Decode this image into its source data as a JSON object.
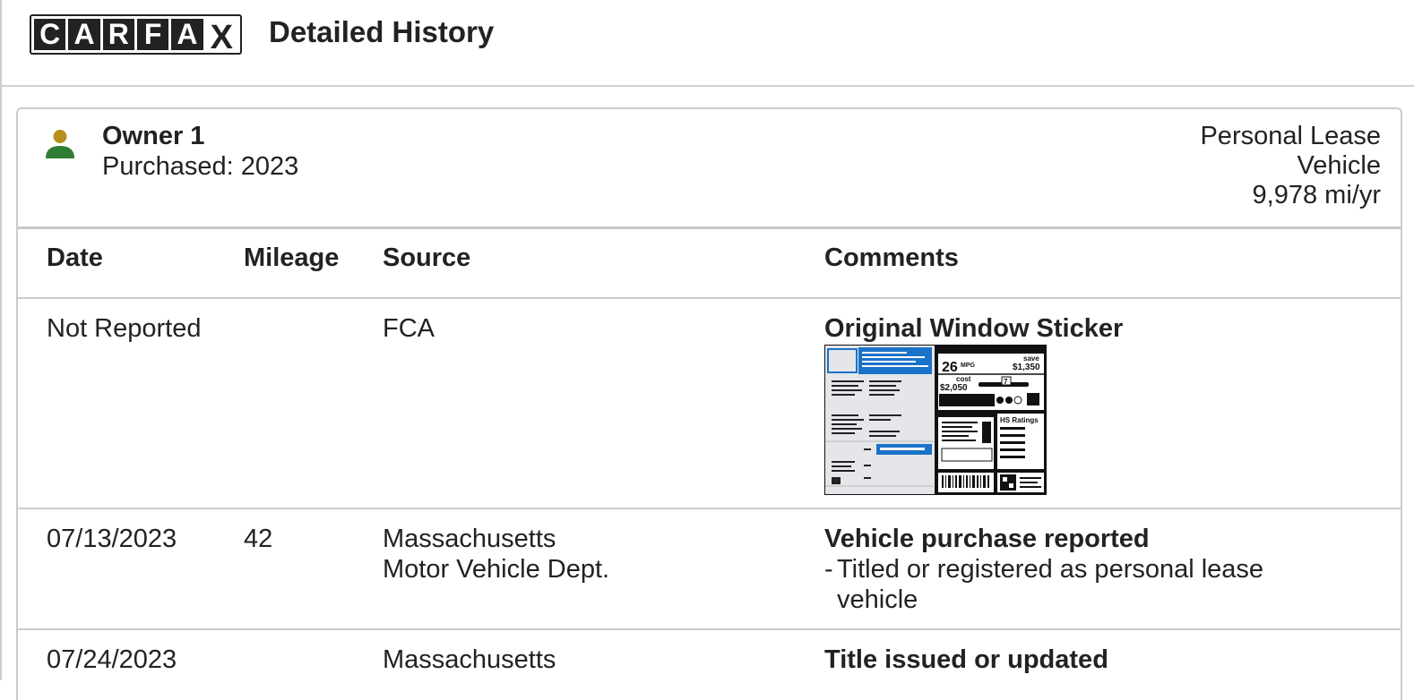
{
  "header": {
    "logo_letters": [
      "C",
      "A",
      "R",
      "F",
      "A",
      "X"
    ],
    "title": "Detailed History"
  },
  "owner": {
    "name": "Owner 1",
    "purchased": "Purchased: 2023",
    "type_line1": "Personal Lease",
    "type_line2": "Vehicle",
    "mileage_per_year": "9,978 mi/yr",
    "icon": "person-icon",
    "colors": {
      "head": "#b8901e",
      "body": "#2e7d32"
    }
  },
  "table": {
    "headers": [
      "Date",
      "Mileage",
      "Source",
      "Comments"
    ],
    "rows": [
      {
        "date": "Not Reported",
        "mileage": "",
        "source_line1": "FCA",
        "source_line2": "",
        "comment_title": "Original Window Sticker",
        "comment_items": [],
        "has_sticker": true
      },
      {
        "date": "07/13/2023",
        "mileage": "42",
        "source_line1": "Massachusetts",
        "source_line2": "Motor Vehicle Dept.",
        "comment_title": "Vehicle purchase reported",
        "comment_items": [
          "Titled or registered as personal lease vehicle"
        ]
      },
      {
        "date": "07/24/2023",
        "mileage": "",
        "source_line1": "Massachusetts",
        "source_line2": "",
        "comment_title": "Title issued or updated",
        "comment_items": []
      }
    ]
  },
  "sticker": {
    "mpg": "26",
    "mpg_unit": "MPG",
    "save_label": "save",
    "save_amount": "$1,350",
    "cost_label": "cost",
    "cost_amount": "$2,050",
    "rating_value": "7",
    "ratings_title": "HS Ratings",
    "accent": "#1a73c8"
  }
}
